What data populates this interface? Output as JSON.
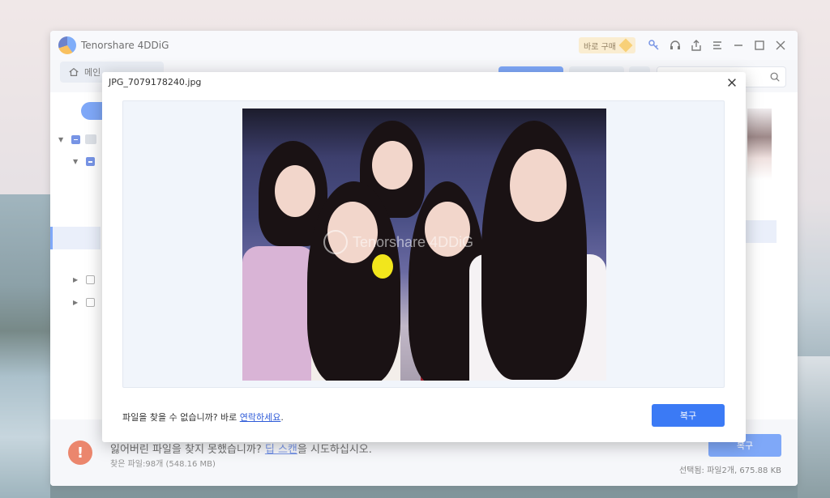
{
  "app": {
    "title": "Tenorshare 4DDiG",
    "buy_label": "바로 구매",
    "home_label": "메인"
  },
  "footer": {
    "lost_text_before": "잃어버린 파일을 찾지 못했습니까? ",
    "deep_scan_link": "딥 스캔",
    "lost_text_after": "을 시도하십시오.",
    "found_files": "찾은 파일:98개 (548.16 MB)",
    "recover_label": "복구",
    "selected_text": "선택됨: 파일2개, 675.88 KB"
  },
  "dialog": {
    "title": "JPG_7079178240.jpg",
    "help_text_before": "파일을 찾을 수 없습니까? 바로 ",
    "contact_link": "연락하세요",
    "help_text_after": ".",
    "recover_label": "복구",
    "watermark": "Tenorshare 4DDiG"
  },
  "colors": {
    "accent": "#3b7af5",
    "warning": "#e1461f"
  }
}
